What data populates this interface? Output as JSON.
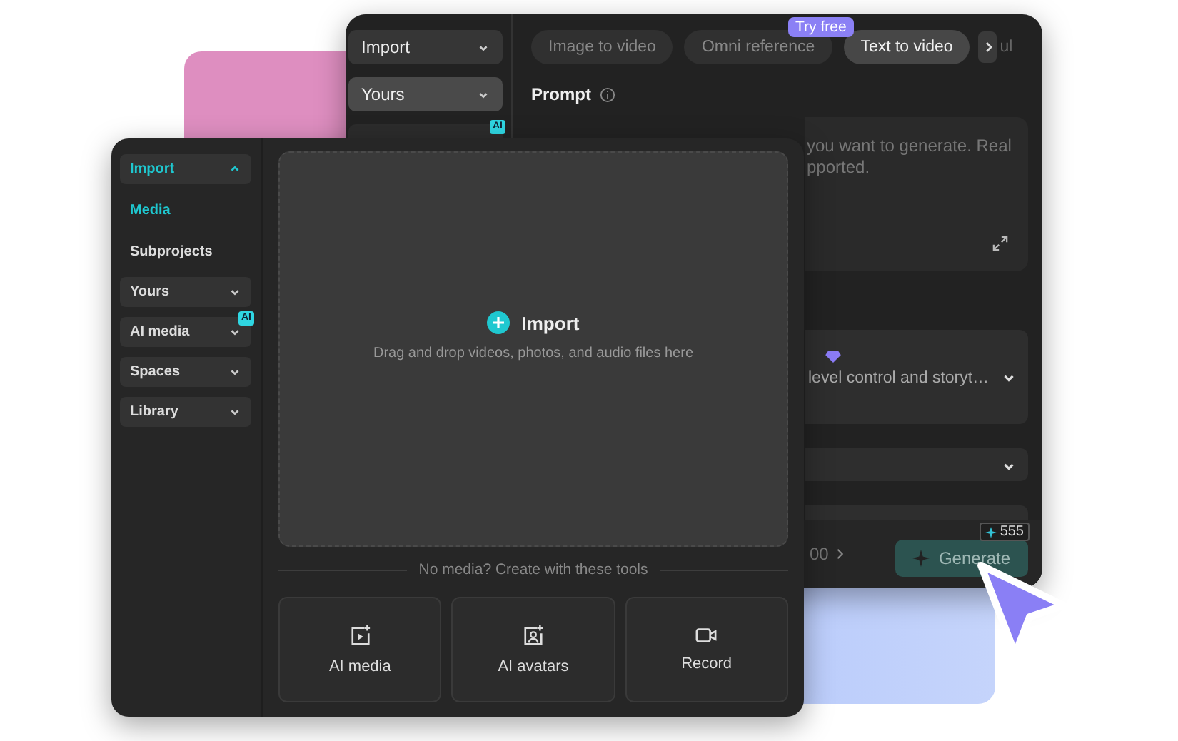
{
  "back_window": {
    "sidebar": [
      {
        "label": "Import",
        "selected": false
      },
      {
        "label": "Yours",
        "selected": true
      }
    ],
    "ai_badge": "AI",
    "try_free": "Try free",
    "tabs": [
      {
        "label": "Image to video",
        "selected": false
      },
      {
        "label": "Omni reference",
        "selected": false
      },
      {
        "label": "Text to video",
        "selected": true
      }
    ],
    "more_tab": "ul",
    "prompt_label": "Prompt",
    "prompt_placeholder": [
      "you want to generate. Real",
      "pported."
    ],
    "model_description": "level control and storyt…",
    "footer_count": "00",
    "generate": "Generate",
    "credits": "555"
  },
  "front_window": {
    "sidebar": [
      {
        "label": "Import",
        "kind": "group",
        "expanded": true,
        "selected": true
      },
      {
        "label": "Media",
        "kind": "link",
        "selected": true
      },
      {
        "label": "Subprojects",
        "kind": "link",
        "selected": false
      },
      {
        "label": "Yours",
        "kind": "group",
        "expanded": false,
        "selected": false
      },
      {
        "label": "AI media",
        "kind": "group",
        "expanded": false,
        "selected": false,
        "badge": "AI"
      },
      {
        "label": "Spaces",
        "kind": "group",
        "expanded": false,
        "selected": false
      },
      {
        "label": "Library",
        "kind": "group",
        "expanded": false,
        "selected": false
      }
    ],
    "drop_zone": {
      "title": "Import",
      "hint": "Drag and drop videos, photos, and audio files here"
    },
    "tools_caption": "No media? Create with these tools",
    "tools": [
      {
        "label": "AI media",
        "kind": "ai-media"
      },
      {
        "label": "AI avatars",
        "kind": "ai-avatars"
      },
      {
        "label": "Record",
        "kind": "record"
      }
    ]
  }
}
